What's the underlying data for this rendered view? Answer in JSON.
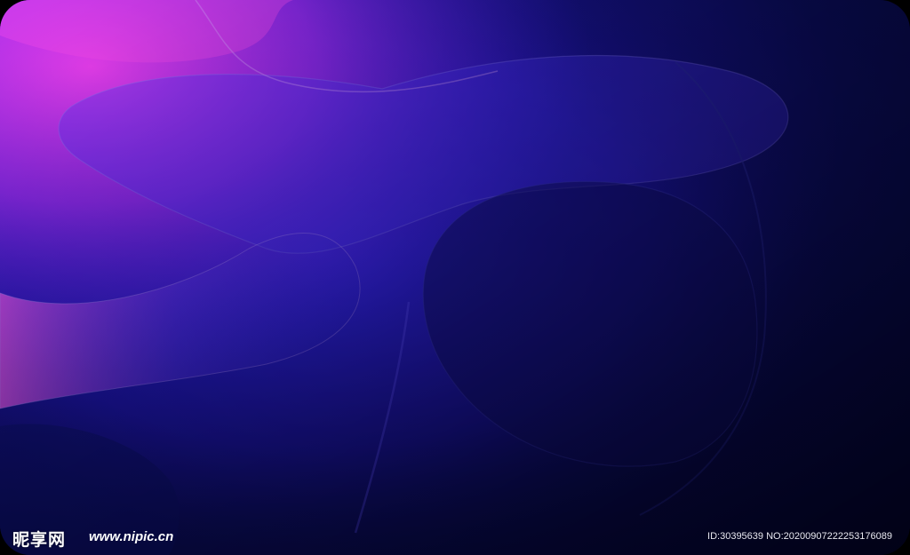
{
  "image": {
    "description_colors": {
      "background_dark": "#05062a",
      "deep_blue": "#1d14a0",
      "violet": "#5a1fe6",
      "magenta": "#e13cf0"
    }
  },
  "watermark": {
    "logo_text": "昵享网",
    "url": "www.nipic.cn",
    "id_text": "ID:30395639 NO:20200907222253176089"
  }
}
